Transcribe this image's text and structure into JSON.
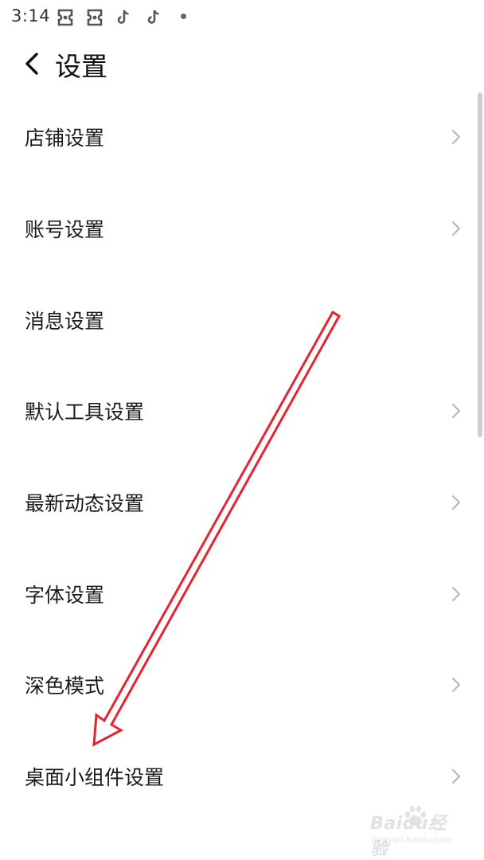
{
  "status_bar": {
    "time": "3:14",
    "icons": [
      "ticket-icon",
      "ticket-icon",
      "tiktok-icon",
      "tiktok-icon",
      "notification-dot-icon"
    ]
  },
  "header": {
    "back_icon": "chevron-left-icon",
    "title": "设置"
  },
  "settings": {
    "items": [
      {
        "label": "店铺设置",
        "has_chevron": true
      },
      {
        "label": "账号设置",
        "has_chevron": true
      },
      {
        "label": "消息设置",
        "has_chevron": false
      },
      {
        "label": "默认工具设置",
        "has_chevron": true
      },
      {
        "label": "最新动态设置",
        "has_chevron": true
      },
      {
        "label": "字体设置",
        "has_chevron": true
      },
      {
        "label": "深色模式",
        "has_chevron": true
      },
      {
        "label": "桌面小组件设置",
        "has_chevron": true
      }
    ]
  },
  "annotation": {
    "type": "arrow",
    "color": "#e8232f"
  },
  "watermark": {
    "brand": "Baidu经验",
    "url": "jingyan.baidu.com"
  },
  "colors": {
    "text": "#1b1b1b",
    "chevron": "#b5b5b5",
    "scrollbar": "#cfcfcf"
  }
}
